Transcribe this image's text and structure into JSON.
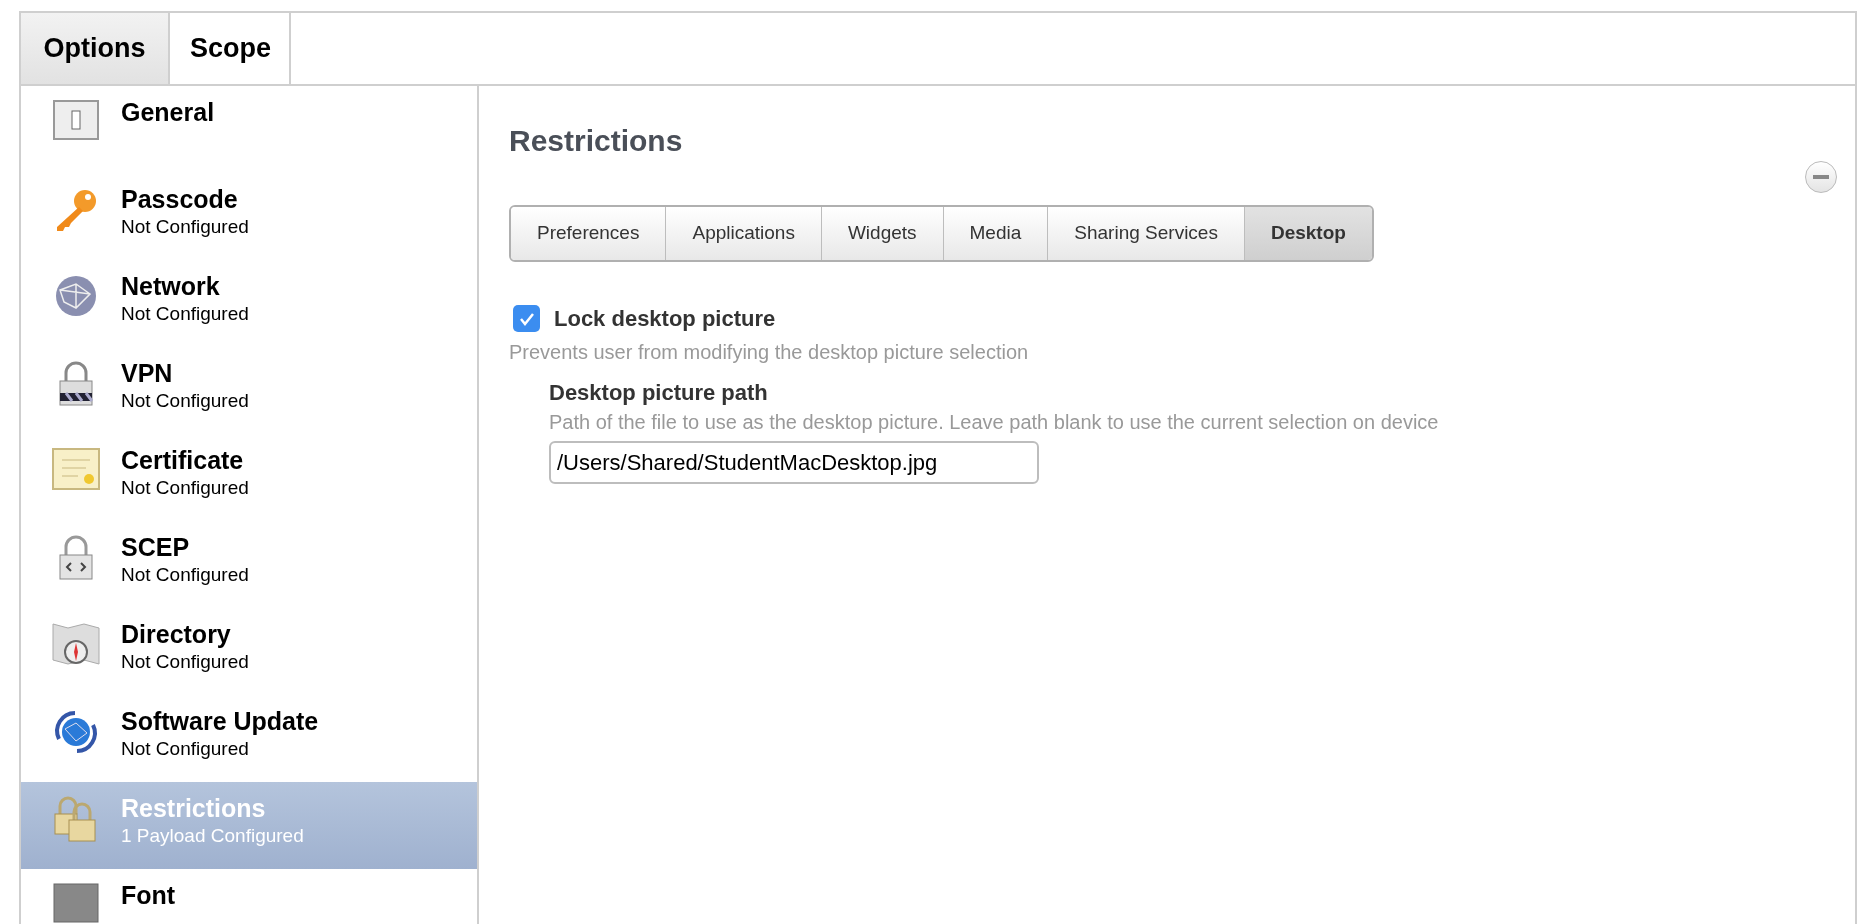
{
  "top_tabs": [
    {
      "label": "Options",
      "selected": true
    },
    {
      "label": "Scope",
      "selected": false
    }
  ],
  "sidebar": {
    "items": [
      {
        "title": "General",
        "selected": false
      },
      {
        "title": "Passcode",
        "subtitle": "Not Configured",
        "selected": false
      },
      {
        "title": "Network",
        "subtitle": "Not Configured",
        "selected": false
      },
      {
        "title": "VPN",
        "subtitle": "Not Configured",
        "selected": false
      },
      {
        "title": "Certificate",
        "subtitle": "Not Configured",
        "selected": false
      },
      {
        "title": "SCEP",
        "subtitle": "Not Configured",
        "selected": false
      },
      {
        "title": "Directory",
        "subtitle": "Not Configured",
        "selected": false
      },
      {
        "title": "Software Update",
        "subtitle": "Not Configured",
        "selected": false
      },
      {
        "title": "Restrictions",
        "subtitle": "1 Payload Configured",
        "selected": true
      },
      {
        "title": "Font",
        "selected": false
      }
    ]
  },
  "panel": {
    "title": "Restrictions",
    "tabs": [
      {
        "label": "Preferences",
        "selected": false
      },
      {
        "label": "Applications",
        "selected": false
      },
      {
        "label": "Widgets",
        "selected": false
      },
      {
        "label": "Media",
        "selected": false
      },
      {
        "label": "Sharing Services",
        "selected": false
      },
      {
        "label": "Desktop",
        "selected": true
      }
    ],
    "lock": {
      "label": "Lock desktop picture",
      "checked": true,
      "description": "Prevents user from modifying the desktop picture selection"
    },
    "path": {
      "label": "Desktop picture path",
      "hint": "Path of the file to use as the desktop picture. Leave path blank to use the current selection on device",
      "value": "/Users/Shared/StudentMacDesktop.jpg"
    }
  }
}
